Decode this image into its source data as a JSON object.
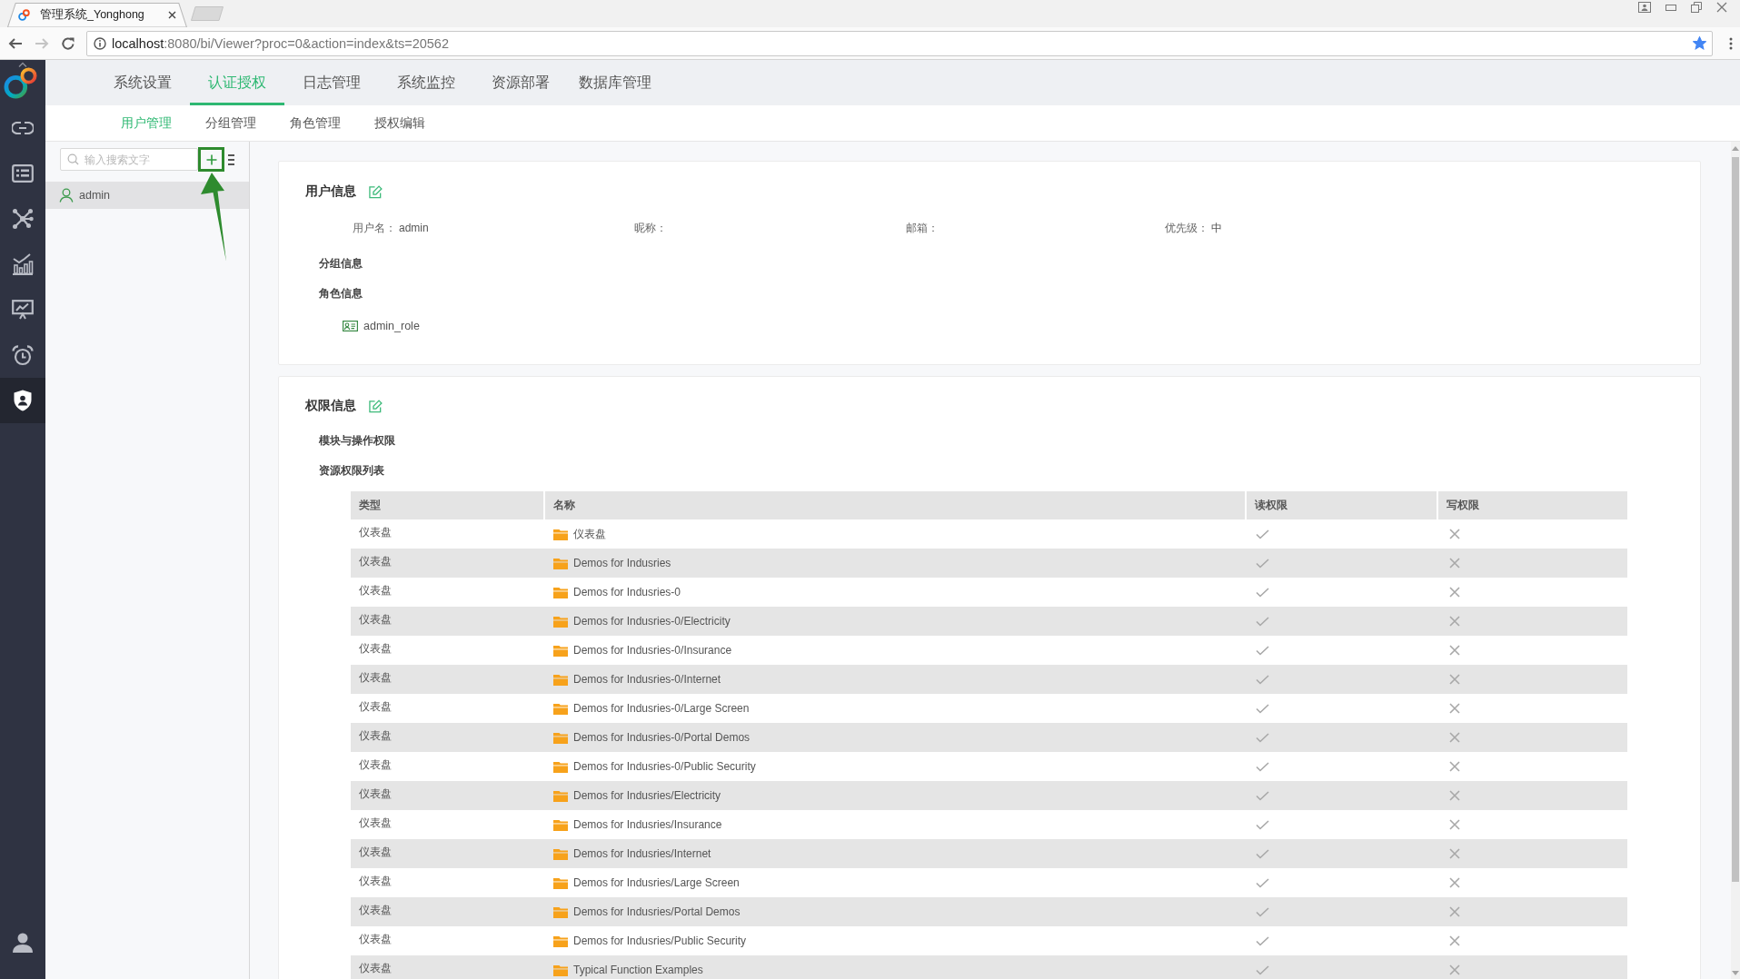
{
  "browser": {
    "tabs": [
      {
        "title": "管理系统_Yonghong",
        "selected": true
      }
    ],
    "can_go_forward": false,
    "url": "localhost:8080/bi/Viewer?proc=0&action=index&ts=20562",
    "bookmarked": true
  },
  "sidebar": {
    "items": [
      {
        "selected": false
      },
      {
        "selected": false
      },
      {
        "selected": false
      },
      {
        "selected": false
      },
      {
        "selected": false
      },
      {
        "selected": false
      },
      {
        "selected": true
      }
    ]
  },
  "nav": {
    "tabs": [
      {
        "label": "系统设置",
        "selected": false
      },
      {
        "label": "认证授权",
        "selected": true
      },
      {
        "label": "日志管理",
        "selected": false
      },
      {
        "label": "系统监控",
        "selected": false
      },
      {
        "label": "资源部署",
        "selected": false
      },
      {
        "label": "数据库管理",
        "selected": false
      }
    ]
  },
  "subnav": {
    "tabs": [
      {
        "label": "用户管理",
        "selected": true
      },
      {
        "label": "分组管理",
        "selected": false
      },
      {
        "label": "角色管理",
        "selected": false
      },
      {
        "label": "授权编辑",
        "selected": false
      }
    ]
  },
  "user_panel": {
    "search": {
      "placeholder": "输入搜索文字"
    },
    "add_button_highlighted": true,
    "users": [
      {
        "name": "admin",
        "selected": true
      }
    ]
  },
  "user_info": {
    "title": "用户信息",
    "fields": [
      {
        "label": "用户名：",
        "value": "admin"
      },
      {
        "label": "昵称："
      },
      {
        "label": "邮箱："
      },
      {
        "label": "优先级：",
        "value": "中"
      }
    ],
    "group_heading": "分组信息",
    "role_heading": "角色信息",
    "roles": [
      {
        "name": "admin_role"
      }
    ]
  },
  "permissions": {
    "title": "权限信息",
    "module_heading": "模块与操作权限",
    "resource_heading": "资源权限列表",
    "table": {
      "columns": [
        "类型",
        "名称",
        "读权限",
        "写权限"
      ],
      "rows": [
        {
          "type": "仪表盘",
          "name": "仪表盘",
          "read": true,
          "write": false
        },
        {
          "type": "仪表盘",
          "name": "Demos for Indusries",
          "read": true,
          "write": false
        },
        {
          "type": "仪表盘",
          "name": "Demos for Indusries-0",
          "read": true,
          "write": false
        },
        {
          "type": "仪表盘",
          "name": "Demos for Indusries-0/Electricity",
          "read": true,
          "write": false
        },
        {
          "type": "仪表盘",
          "name": "Demos for Indusries-0/Insurance",
          "read": true,
          "write": false
        },
        {
          "type": "仪表盘",
          "name": "Demos for Indusries-0/Internet",
          "read": true,
          "write": false
        },
        {
          "type": "仪表盘",
          "name": "Demos for Indusries-0/Large Screen",
          "read": true,
          "write": false
        },
        {
          "type": "仪表盘",
          "name": "Demos for Indusries-0/Portal Demos",
          "read": true,
          "write": false
        },
        {
          "type": "仪表盘",
          "name": "Demos for Indusries-0/Public Security",
          "read": true,
          "write": false
        },
        {
          "type": "仪表盘",
          "name": "Demos for Indusries/Electricity",
          "read": true,
          "write": false
        },
        {
          "type": "仪表盘",
          "name": "Demos for Indusries/Insurance",
          "read": true,
          "write": false
        },
        {
          "type": "仪表盘",
          "name": "Demos for Indusries/Internet",
          "read": true,
          "write": false
        },
        {
          "type": "仪表盘",
          "name": "Demos for Indusries/Large Screen",
          "read": true,
          "write": false
        },
        {
          "type": "仪表盘",
          "name": "Demos for Indusries/Portal Demos",
          "read": true,
          "write": false
        },
        {
          "type": "仪表盘",
          "name": "Demos for Indusries/Public Security",
          "read": true,
          "write": false
        },
        {
          "type": "仪表盘",
          "name": "Typical Function Examples",
          "read": true,
          "write": false
        }
      ]
    }
  }
}
